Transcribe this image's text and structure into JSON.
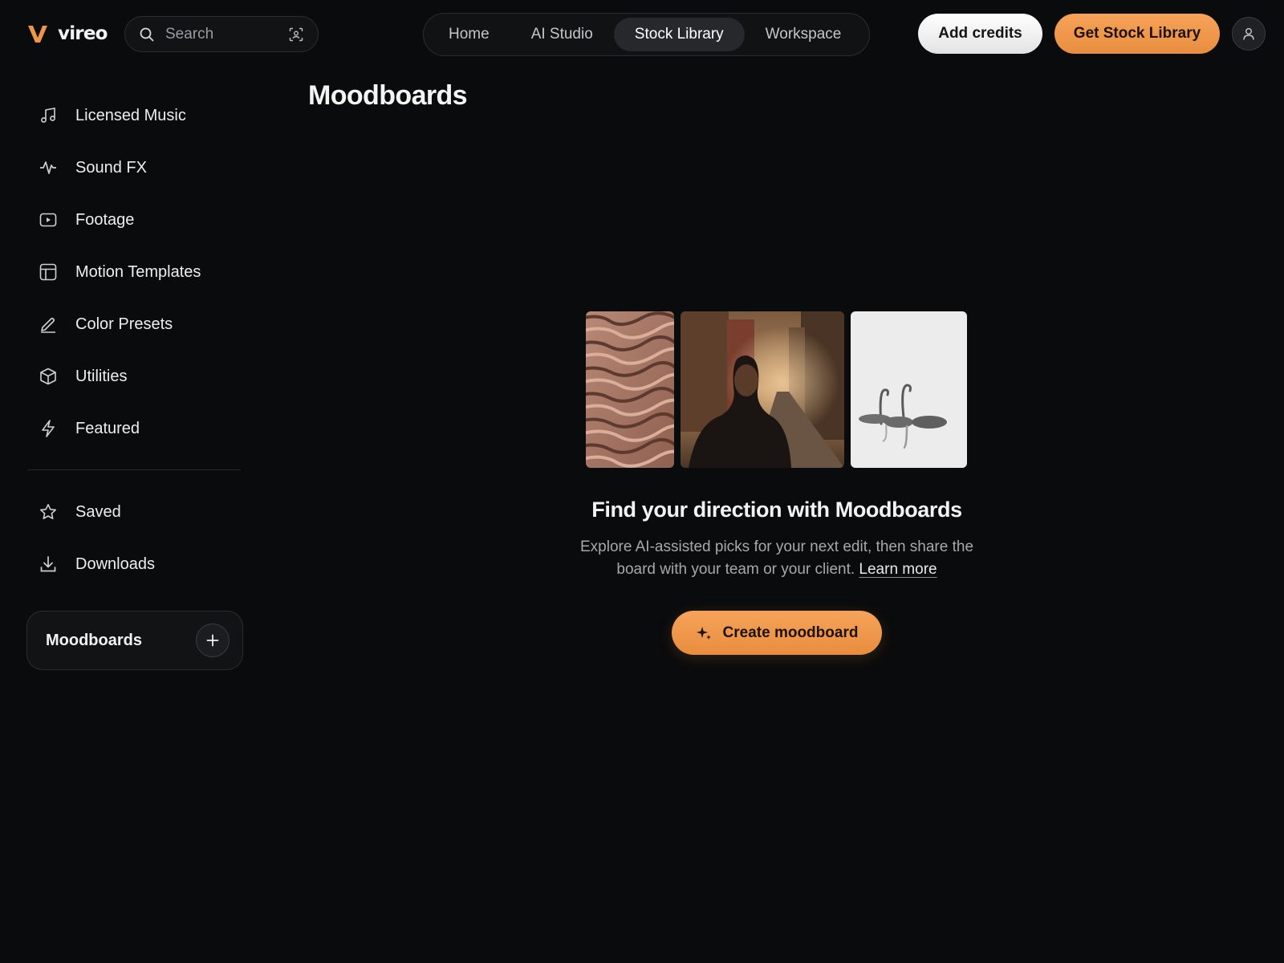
{
  "brand": {
    "name": "vireo",
    "accent": "#f09447"
  },
  "search": {
    "placeholder": "Search",
    "value": "",
    "icon": "search-icon",
    "action_icon": "image-scan-icon"
  },
  "nav": {
    "tabs": [
      {
        "label": "Home",
        "active": false
      },
      {
        "label": "AI Studio",
        "active": false
      },
      {
        "label": "Stock Library",
        "active": true
      },
      {
        "label": "Workspace",
        "active": false
      }
    ]
  },
  "header_actions": {
    "add_credits_label": "Add credits",
    "get_stock_label": "Get Stock Library",
    "avatar_icon": "user-icon"
  },
  "sidebar": {
    "items": [
      {
        "label": "Licensed Music",
        "icon": "music-note-icon"
      },
      {
        "label": "Sound FX",
        "icon": "waveform-icon"
      },
      {
        "label": "Footage",
        "icon": "video-play-icon"
      },
      {
        "label": "Motion Templates",
        "icon": "layout-template-icon"
      },
      {
        "label": "Color Presets",
        "icon": "pen-icon"
      },
      {
        "label": "Utilities",
        "icon": "cube-icon"
      },
      {
        "label": "Featured",
        "icon": "lightning-icon"
      }
    ],
    "secondary": [
      {
        "label": "Saved",
        "icon": "star-icon"
      },
      {
        "label": "Downloads",
        "icon": "download-icon"
      }
    ],
    "moodboards": {
      "label": "Moodboards",
      "add_icon": "plus-icon"
    }
  },
  "main": {
    "title": "Moodboards",
    "empty_state": {
      "heading": "Find your direction with Moodboards",
      "description": "Explore AI-assisted picks for your next edit, then share the board with your team or your client.",
      "learn_more": "Learn more",
      "cta": "Create moodboard",
      "cta_icon": "sparkle-icon",
      "images": [
        "sand-dunes-image",
        "person-street-image",
        "swans-image"
      ]
    }
  }
}
